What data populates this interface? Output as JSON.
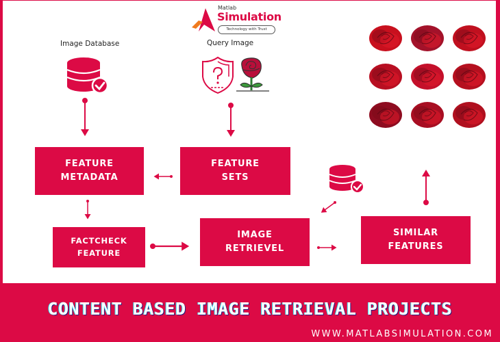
{
  "logo": {
    "small": "Matlab",
    "big": "Simulation",
    "tagline": "Technology with Trust"
  },
  "labels": {
    "image_database": "Image Database",
    "query_image": "Query Image"
  },
  "boxes": {
    "feature_metadata": [
      "FEATURE",
      "METADATA"
    ],
    "feature_sets": [
      "FEATURE",
      "SETS"
    ],
    "factcheck_feature": [
      "FACTCHECK",
      "FEATURE"
    ],
    "image_retrieval": [
      "IMAGE",
      "RETRIEVEL"
    ],
    "similar_features": [
      "SIMILAR",
      "FEATURES"
    ]
  },
  "icons": {
    "database": "database-check-icon",
    "query": "shield-question-icon",
    "rose": "rose-icon"
  },
  "results": {
    "count": 9,
    "description": "grid of red rose images"
  },
  "footer": {
    "title": "CONTENT BASED IMAGE RETRIEVAL PROJECTS",
    "url": "WWW.MATLABSIMULATION.COM"
  },
  "colors": {
    "accent": "#dc0a45",
    "background": "#ffffff",
    "text": "#222222"
  }
}
